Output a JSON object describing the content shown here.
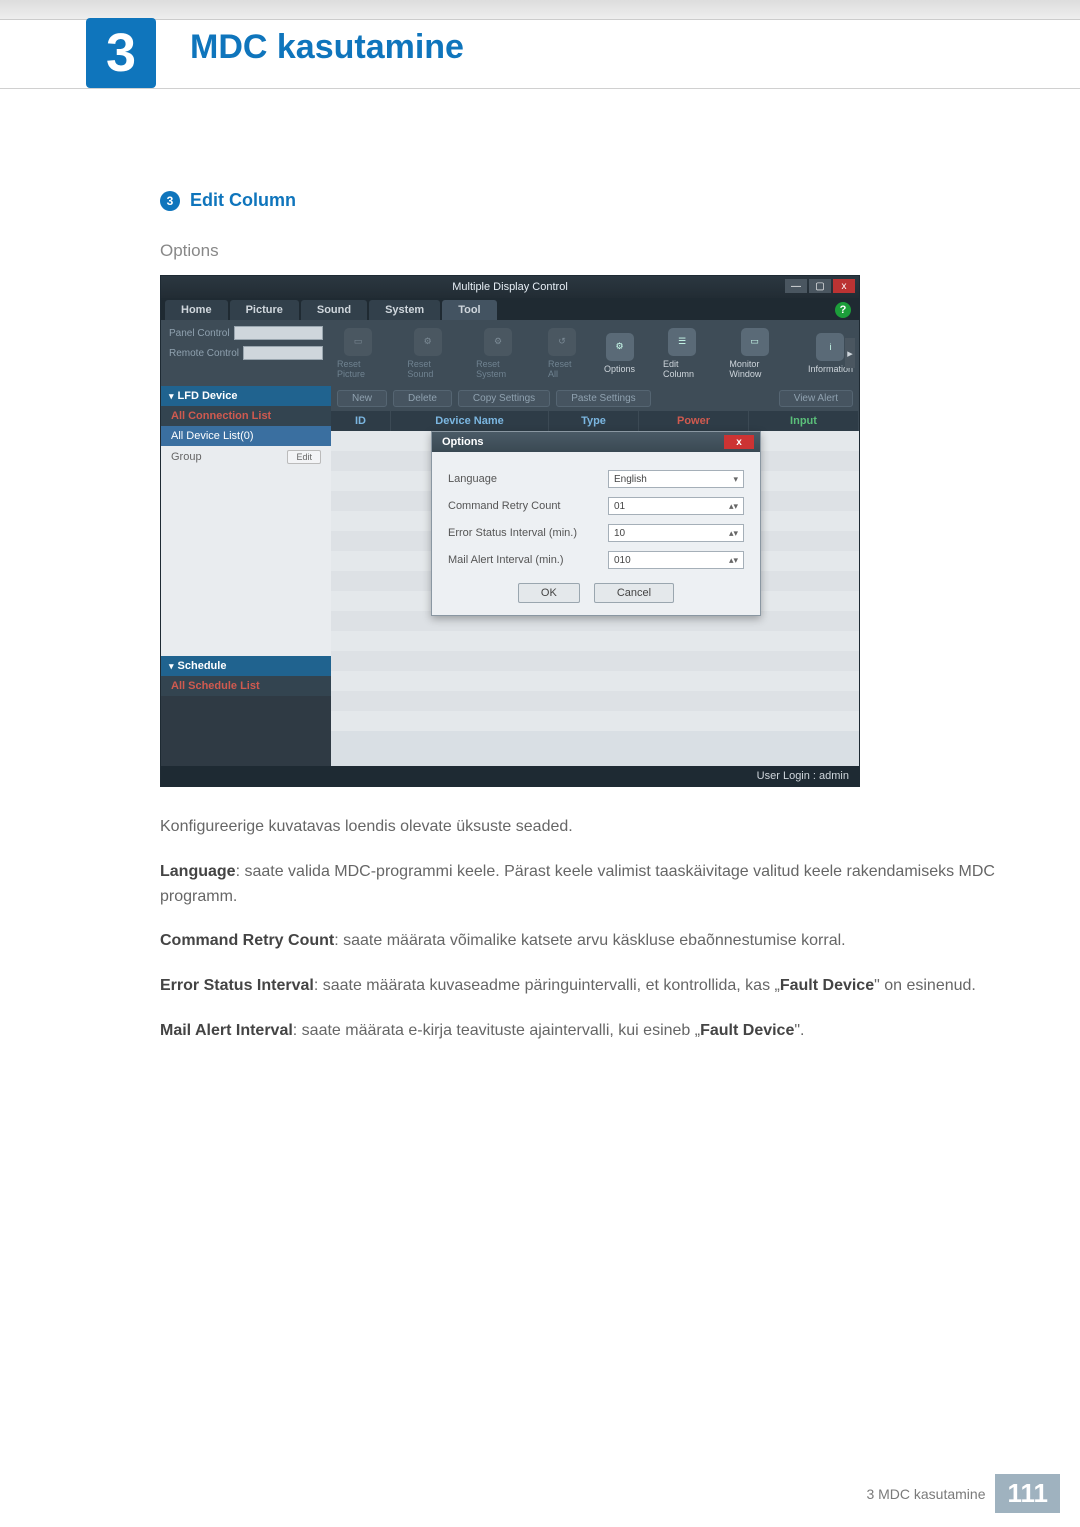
{
  "chapter": {
    "number": "3",
    "title": "MDC kasutamine"
  },
  "subsection": {
    "bullet": "3",
    "title": "Edit Column"
  },
  "options_label": "Options",
  "app": {
    "title": "Multiple Display Control",
    "help_icon": "?",
    "win": {
      "min": "—",
      "max": "▢",
      "close": "x"
    },
    "tabs": [
      "Home",
      "Picture",
      "Sound",
      "System",
      "Tool"
    ],
    "active_tab": 4,
    "ribbon_left": {
      "panel_control": "Panel Control",
      "remote_control": "Remote Control"
    },
    "ribbon_tools": [
      {
        "label": "Reset Picture",
        "bright": false
      },
      {
        "label": "Reset Sound",
        "bright": false
      },
      {
        "label": "Reset System",
        "bright": false
      },
      {
        "label": "Reset All",
        "bright": false
      },
      {
        "label": "Options",
        "bright": true
      },
      {
        "label": "Edit Column",
        "bright": true
      },
      {
        "label": "Monitor Window",
        "bright": true
      },
      {
        "label": "Information",
        "bright": true
      }
    ],
    "side": {
      "lfd_device": "LFD Device",
      "all_connection_list": "All Connection List",
      "all_device_list": "All Device List(0)",
      "group": "Group",
      "edit": "Edit",
      "schedule": "Schedule",
      "all_schedule_list": "All Schedule List"
    },
    "toolbar": {
      "new": "New",
      "delete": "Delete",
      "copy": "Copy Settings",
      "paste": "Paste Settings",
      "view": "View Alert"
    },
    "grid_headers": {
      "id": "ID",
      "name": "Device Name",
      "type": "Type",
      "power": "Power",
      "input": "Input"
    },
    "dialog": {
      "title": "Options",
      "rows": {
        "language": {
          "label": "Language",
          "value": "English"
        },
        "retry": {
          "label": "Command Retry Count",
          "value": "01"
        },
        "error_interval": {
          "label": "Error Status Interval (min.)",
          "value": "10"
        },
        "mail_interval": {
          "label": "Mail Alert Interval (min.)",
          "value": "010"
        }
      },
      "buttons": {
        "ok": "OK",
        "cancel": "Cancel"
      }
    },
    "footer": "User Login : admin"
  },
  "paragraphs": {
    "p1": "Konfigureerige kuvatavas loendis olevate üksuste seaded.",
    "p2a": "Language",
    "p2b": ": saate valida MDC-programmi keele. Pärast keele valimist taaskäivitage valitud keele rakendamiseks MDC programm.",
    "p3a": "Command Retry Count",
    "p3b": ": saate määrata võimalike katsete arvu käskluse ebaõnnestumise korral.",
    "p4a": "Error Status Interval",
    "p4b": ": saate määrata kuvaseadme päringuintervalli, et kontrollida, kas „",
    "p4c": "Fault Device",
    "p4d": "\" on esinenud.",
    "p5a": "Mail Alert Interval",
    "p5b": ": saate määrata e-kirja teavituste ajaintervalli, kui esineb „",
    "p5c": "Fault Device",
    "p5d": "\"."
  },
  "page_footer": {
    "label": "3 MDC kasutamine",
    "page": "111"
  }
}
